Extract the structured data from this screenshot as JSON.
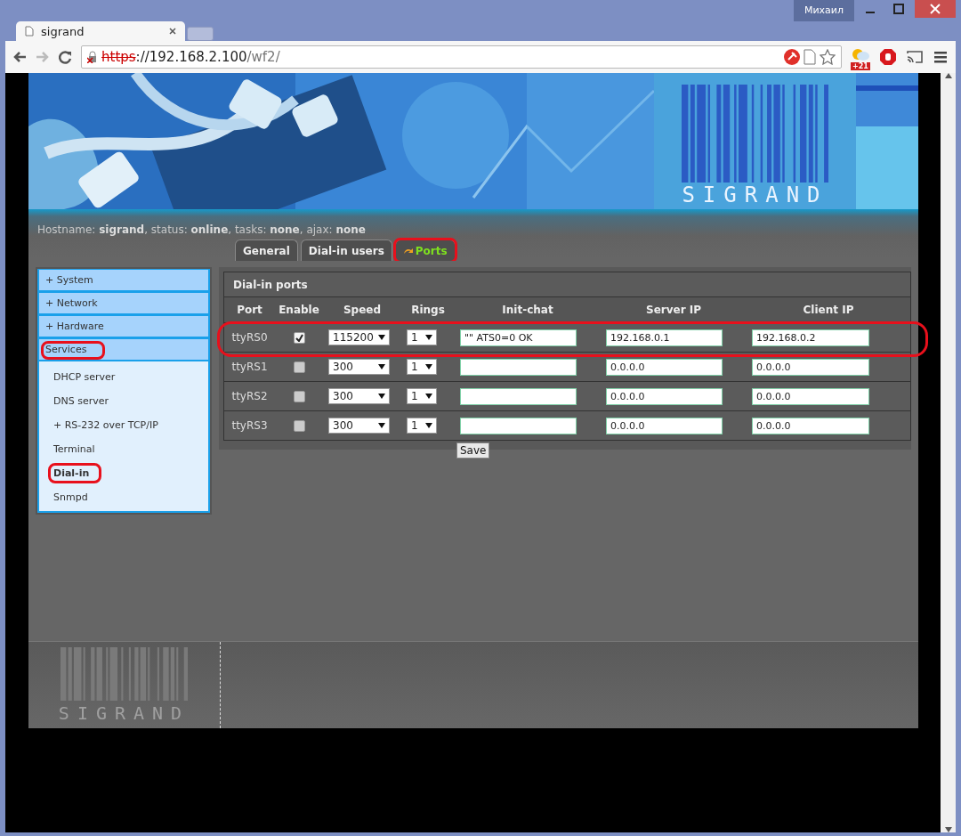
{
  "window": {
    "user": "Михаил"
  },
  "browser_tabs": [
    {
      "title": "sigrand",
      "selected": true
    }
  ],
  "address_bar": {
    "scheme": "https",
    "host": "://192.168.2.100",
    "path": "/wf2/"
  },
  "extension_badge": "+21",
  "banner": {
    "logo": "SIGRAND"
  },
  "status_line": "Hostname: **sigrand**, status: **online**, tasks: **none**, ajax: **none**",
  "page_tabs": [
    {
      "label": "General",
      "selected": false,
      "circled": false
    },
    {
      "label": "Dial-in users",
      "selected": false,
      "circled": false
    },
    {
      "label": "Ports",
      "selected": true,
      "circled": true
    }
  ],
  "sidebar": {
    "items": [
      {
        "label": "+ System",
        "circled": false
      },
      {
        "label": "+ Network",
        "circled": false
      },
      {
        "label": "+ Hardware",
        "circled": false
      },
      {
        "label": "Services",
        "expanded": true,
        "circled": true,
        "children": [
          {
            "label": "DHCP server",
            "selected": false,
            "circled": false
          },
          {
            "label": "DNS server",
            "selected": false,
            "circled": false
          },
          {
            "label": "+ RS-232 over TCP/IP",
            "selected": false,
            "circled": false
          },
          {
            "label": "Terminal",
            "selected": false,
            "circled": false
          },
          {
            "label": "Dial-in",
            "selected": true,
            "circled": true
          },
          {
            "label": "Snmpd",
            "selected": false,
            "circled": false
          }
        ]
      }
    ]
  },
  "table": {
    "title": "Dial-in ports",
    "columns": [
      "Port",
      "Enable",
      "Speed",
      "Rings",
      "Init-chat",
      "Server IP",
      "Client IP"
    ],
    "rows": [
      {
        "port": "ttyRS0",
        "enabled": true,
        "speed": "115200",
        "rings": "1",
        "init_chat": "\"\" ATS0=0 OK",
        "server_ip": "192.168.0.1",
        "client_ip": "192.168.0.2",
        "circled": true
      },
      {
        "port": "ttyRS1",
        "enabled": false,
        "speed": "300",
        "rings": "1",
        "server_ip": "0.0.0.0",
        "client_ip": "0.0.0.0",
        "circled": false
      },
      {
        "port": "ttyRS2",
        "enabled": false,
        "speed": "300",
        "rings": "1",
        "server_ip": "0.0.0.0",
        "client_ip": "0.0.0.0",
        "circled": false
      },
      {
        "port": "ttyRS3",
        "enabled": false,
        "speed": "300",
        "rings": "1",
        "server_ip": "0.0.0.0",
        "client_ip": "0.0.0.0",
        "circled": false
      }
    ]
  },
  "save_button": "Save",
  "footer": {
    "logo": "SIGRAND"
  }
}
